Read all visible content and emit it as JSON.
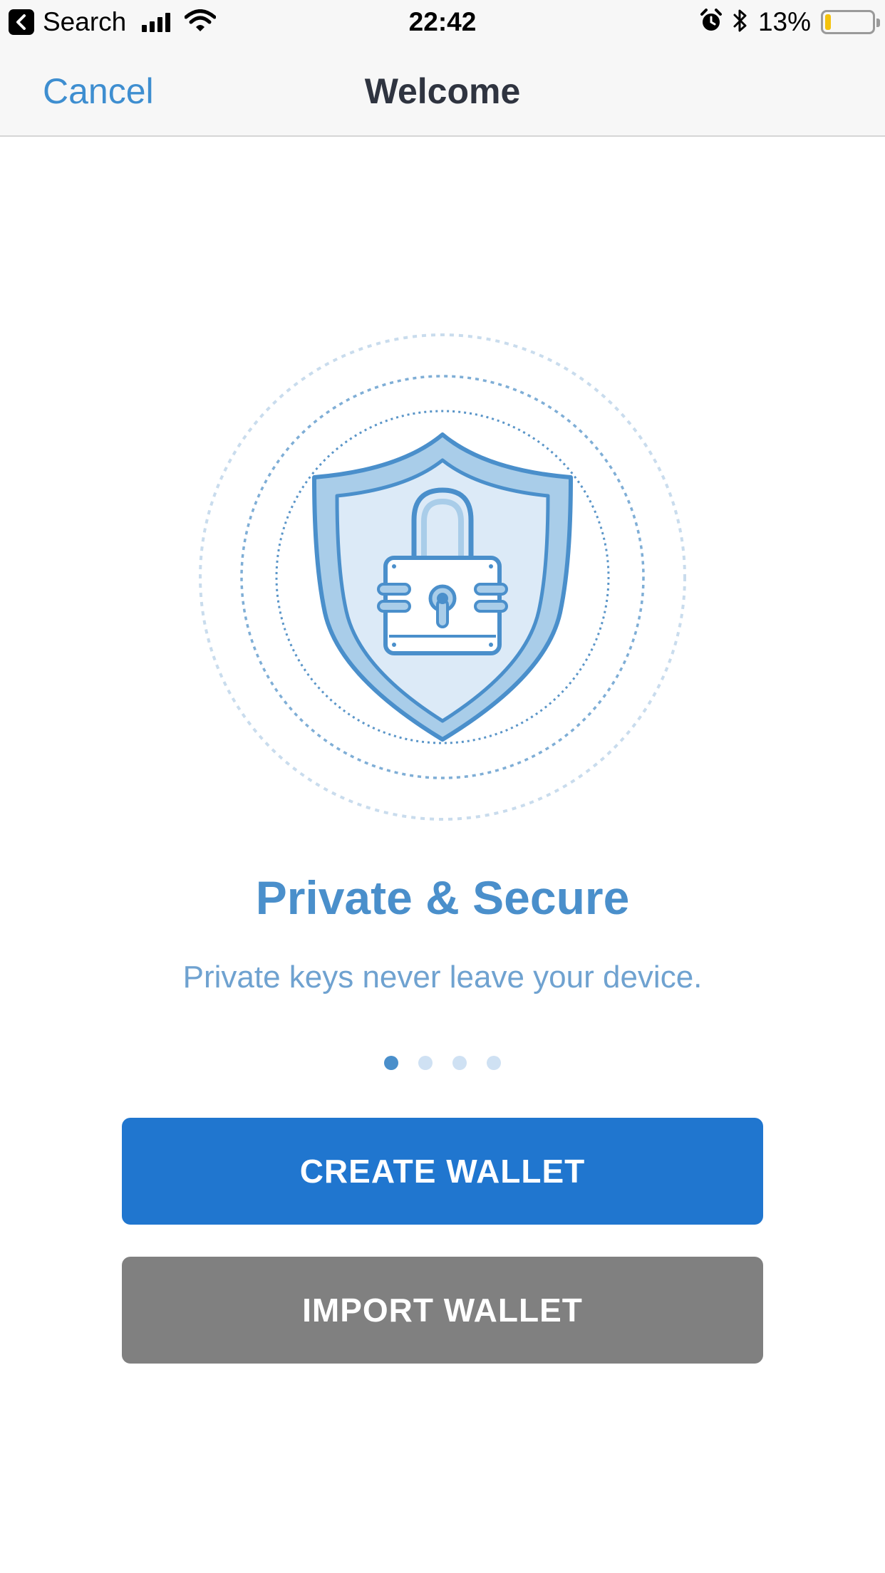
{
  "status_bar": {
    "back_app": "Search",
    "time": "22:42",
    "battery_text": "13%",
    "battery_level": 0.13,
    "battery_color": "#f4c20d",
    "icons": [
      "back-arrow-icon",
      "signal-icon",
      "wifi-icon",
      "alarm-icon",
      "bluetooth-icon",
      "battery-icon"
    ]
  },
  "nav": {
    "cancel_label": "Cancel",
    "title": "Welcome"
  },
  "onboarding": {
    "illustration_icon": "shield-lock-icon",
    "headline": "Private & Secure",
    "subline": "Private keys never leave your device.",
    "page_count": 4,
    "active_page": 1
  },
  "actions": {
    "create_label": "CREATE WALLET",
    "import_label": "IMPORT WALLET"
  },
  "colors": {
    "accent": "#3e8ed0",
    "primary_button": "#2076cf",
    "secondary_button": "#808080",
    "headline": "#4a8fcb"
  }
}
